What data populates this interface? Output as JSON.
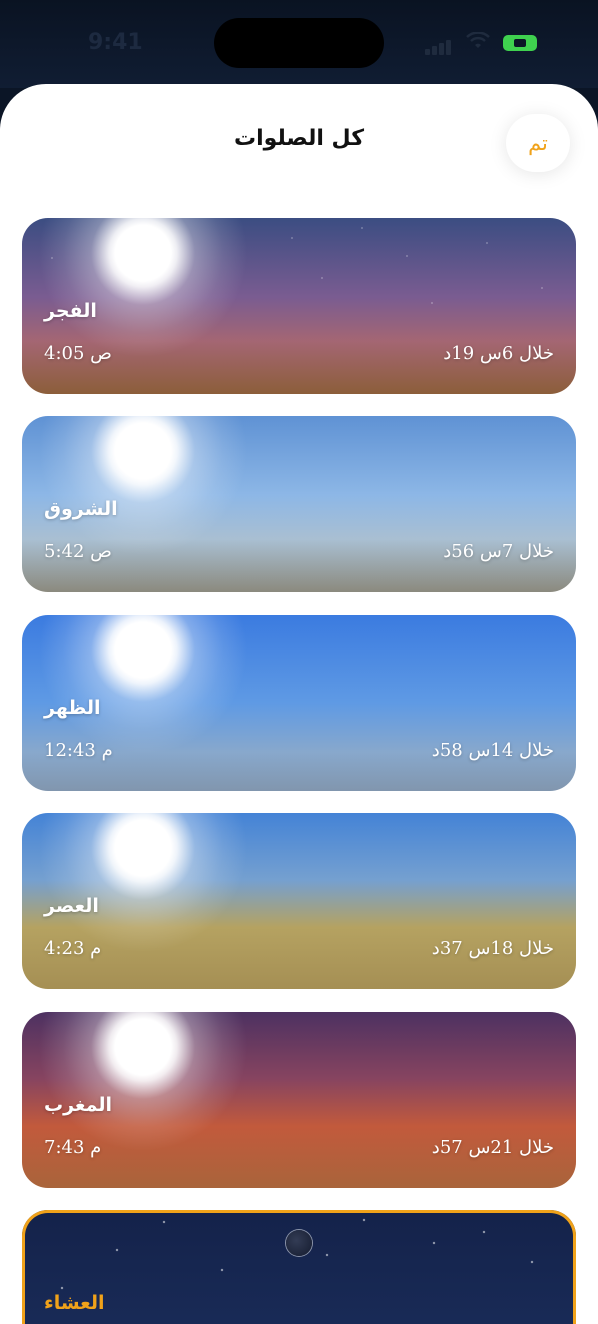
{
  "status": {
    "time": "9:41"
  },
  "header": {
    "title": "كل الصلوات",
    "done_label": "تم"
  },
  "prayers": [
    {
      "name": "الفجر",
      "time": "4:05 ص",
      "countdown": "خلال 6س 19د"
    },
    {
      "name": "الشروق",
      "time": "5:42 ص",
      "countdown": "خلال 7س 56د"
    },
    {
      "name": "الظهر",
      "time": "12:43 م",
      "countdown": "خلال 14س 58د"
    },
    {
      "name": "العصر",
      "time": "4:23 م",
      "countdown": "خلال 18س 37د"
    },
    {
      "name": "المغرب",
      "time": "7:43 م",
      "countdown": "خلال 21س 57د"
    },
    {
      "name": "العشاء"
    }
  ],
  "colors": {
    "accent": "#f0a21a"
  }
}
